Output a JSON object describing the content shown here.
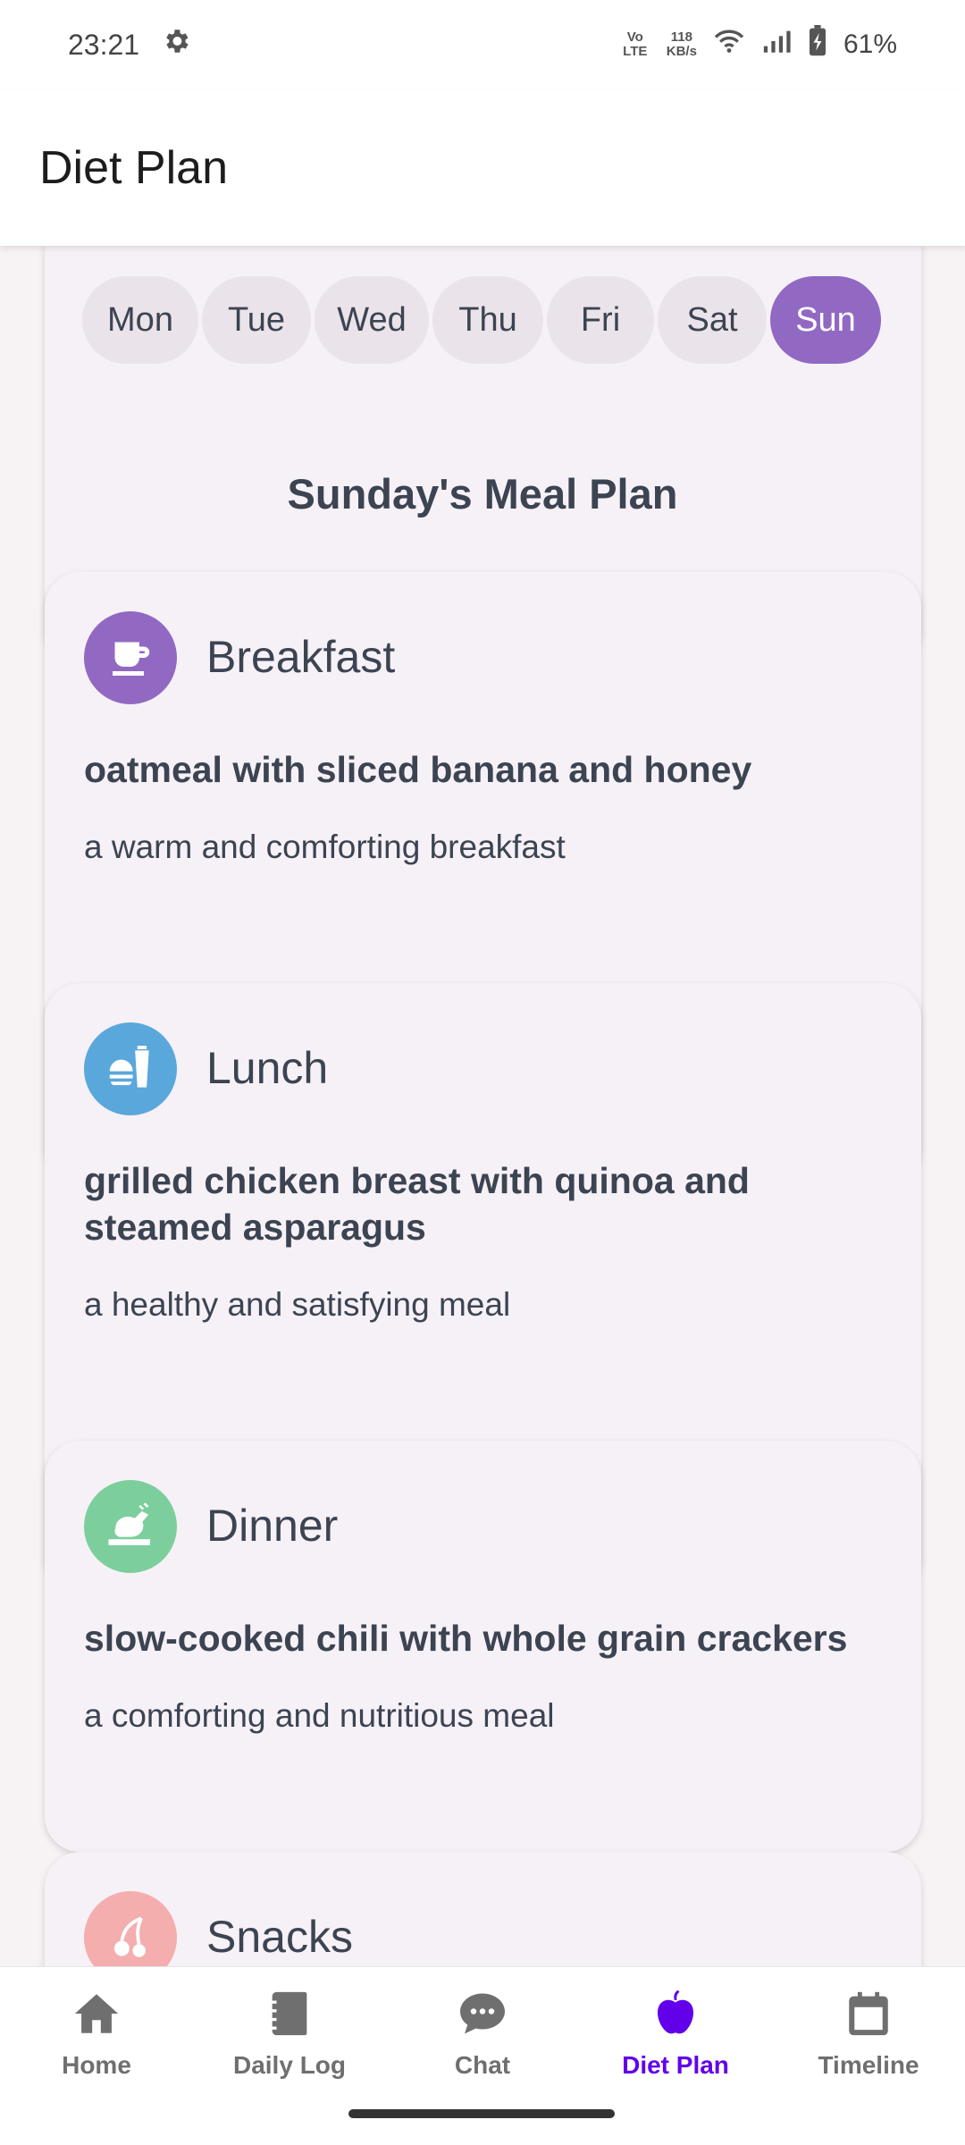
{
  "status": {
    "time": "23:21",
    "volte": "Vo LTE",
    "net_speed_value": "118",
    "net_speed_unit": "KB/s",
    "battery": "61%"
  },
  "app": {
    "title": "Diet Plan"
  },
  "days": [
    {
      "label": "Mon",
      "selected": false
    },
    {
      "label": "Tue",
      "selected": false
    },
    {
      "label": "Wed",
      "selected": false
    },
    {
      "label": "Thu",
      "selected": false
    },
    {
      "label": "Fri",
      "selected": false
    },
    {
      "label": "Sat",
      "selected": false
    },
    {
      "label": "Sun",
      "selected": true
    }
  ],
  "section_title": "Sunday's Meal Plan",
  "meals": [
    {
      "name": "Breakfast",
      "dish": "oatmeal with sliced banana and honey",
      "description": "a warm and comforting breakfast",
      "icon": "coffee-cup-icon",
      "color": "#9169c3"
    },
    {
      "name": "Lunch",
      "dish": "grilled chicken breast with quinoa and steamed asparagus",
      "description": "a healthy and satisfying meal",
      "icon": "burger-drink-icon",
      "color": "#5aa7dc"
    },
    {
      "name": "Dinner",
      "dish": "slow-cooked chili with whole grain crackers",
      "description": "a comforting and nutritious meal",
      "icon": "roast-turkey-icon",
      "color": "#7ccf9c"
    },
    {
      "name": "Snacks",
      "icon": "cherries-icon",
      "color": "#f4aeae"
    }
  ],
  "nav": [
    {
      "label": "Home",
      "icon": "home-icon",
      "active": false
    },
    {
      "label": "Daily Log",
      "icon": "journal-icon",
      "active": false
    },
    {
      "label": "Chat",
      "icon": "chat-icon",
      "active": false
    },
    {
      "label": "Diet Plan",
      "icon": "apple-icon",
      "active": true
    },
    {
      "label": "Timeline",
      "icon": "calendar-icon",
      "active": false
    }
  ],
  "colors": {
    "accent": "#9169c3",
    "nav_active": "#6200ea",
    "text": "#3c4452",
    "background": "#f7f2f3",
    "card": "#f6f1f7"
  }
}
